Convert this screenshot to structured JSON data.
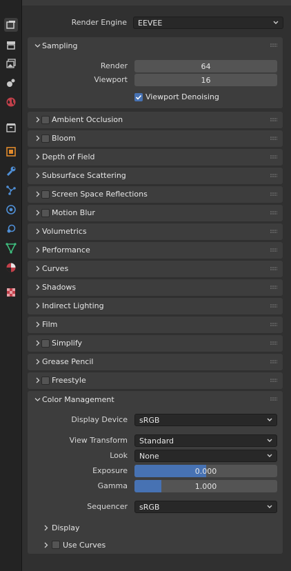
{
  "render_engine": {
    "label": "Render Engine",
    "value": "EEVEE"
  },
  "sampling": {
    "title": "Sampling",
    "render_label": "Render",
    "render_value": "64",
    "viewport_label": "Viewport",
    "viewport_value": "16",
    "denoise_label": "Viewport Denoising",
    "denoise_checked": true
  },
  "panels": [
    {
      "title": "Ambient Occlusion",
      "checkbox": true
    },
    {
      "title": "Bloom",
      "checkbox": true
    },
    {
      "title": "Depth of Field",
      "checkbox": false
    },
    {
      "title": "Subsurface Scattering",
      "checkbox": false
    },
    {
      "title": "Screen Space Reflections",
      "checkbox": true
    },
    {
      "title": "Motion Blur",
      "checkbox": true
    },
    {
      "title": "Volumetrics",
      "checkbox": false
    },
    {
      "title": "Performance",
      "checkbox": false
    },
    {
      "title": "Curves",
      "checkbox": false
    },
    {
      "title": "Shadows",
      "checkbox": false
    },
    {
      "title": "Indirect Lighting",
      "checkbox": false
    },
    {
      "title": "Film",
      "checkbox": false
    },
    {
      "title": "Simplify",
      "checkbox": true
    },
    {
      "title": "Grease Pencil",
      "checkbox": false
    },
    {
      "title": "Freestyle",
      "checkbox": true
    }
  ],
  "color_management": {
    "title": "Color Management",
    "display_device_label": "Display Device",
    "display_device_value": "sRGB",
    "view_transform_label": "View Transform",
    "view_transform_value": "Standard",
    "look_label": "Look",
    "look_value": "None",
    "exposure_label": "Exposure",
    "exposure_value": "0.000",
    "exposure_fill": 0.5,
    "gamma_label": "Gamma",
    "gamma_value": "1.000",
    "gamma_fill": 0.19,
    "sequencer_label": "Sequencer",
    "sequencer_value": "sRGB",
    "display_sub": "Display",
    "use_curves_sub": "Use Curves"
  },
  "tabs": [
    "tool-icon",
    "render-icon",
    "output-icon",
    "view-layer-icon",
    "scene-icon",
    "world-icon",
    "collection-icon",
    "object-icon",
    "modifier-icon",
    "particles-icon",
    "physics-icon",
    "constraints-icon",
    "data-icon",
    "material-icon",
    "texture-icon"
  ]
}
